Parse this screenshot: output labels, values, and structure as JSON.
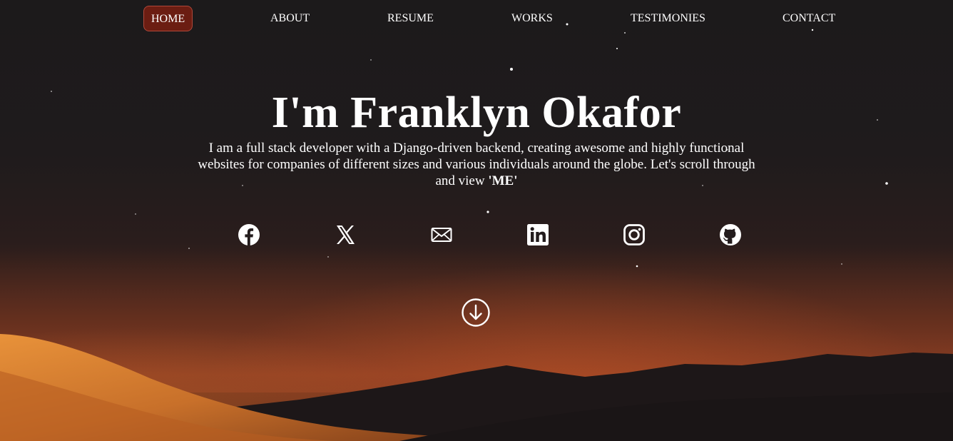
{
  "nav": {
    "items": [
      {
        "label": "HOME",
        "active": true
      },
      {
        "label": "ABOUT",
        "active": false
      },
      {
        "label": "RESUME",
        "active": false
      },
      {
        "label": "WORKS",
        "active": false
      },
      {
        "label": "TESTIMONIES",
        "active": false
      },
      {
        "label": "CONTACT",
        "active": false
      }
    ],
    "active_bg": "#6b1d12"
  },
  "hero": {
    "title": "I'm Franklyn Okafor",
    "intro_text": "I am a full stack developer with a Django-driven backend, creating awesome and highly functional websites for companies of different sizes and various individuals around the globe. Let's scroll through and view ",
    "intro_emphasis": "'ME'"
  },
  "social": {
    "icons": [
      "facebook-icon",
      "x-twitter-icon",
      "envelope-icon",
      "linkedin-icon",
      "instagram-icon",
      "github-icon"
    ]
  },
  "scroll_icon": "arrow-down-circle-icon",
  "colors": {
    "text": "#ffffff",
    "sky": "#1c1a1b",
    "dune_orange": "#c8702a"
  }
}
